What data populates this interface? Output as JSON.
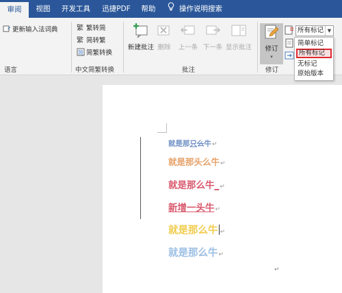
{
  "tabs": [
    {
      "label": "审阅",
      "active": true
    },
    {
      "label": "视图"
    },
    {
      "label": "开发工具"
    },
    {
      "label": "迅捷PDF"
    },
    {
      "label": "帮助"
    }
  ],
  "tell_me": "操作说明搜索",
  "ribbon": {
    "language": {
      "update_ime_label": "更新输入法词典",
      "group_label": "语言"
    },
    "chinese_conversion": {
      "trad_to_simp": "繁转简",
      "simp_to_trad": "简转繁",
      "conversion": "简繁转换",
      "group_label": "中文简繁转换"
    },
    "comments": {
      "new_comment": "新建批注",
      "delete": "删除",
      "previous": "上一条",
      "next": "下一条",
      "show_comments": "显示批注",
      "group_label": "批注"
    },
    "tracking": {
      "track_changes": "修订",
      "group_label": "修订",
      "markup_combo_value": "所有标记",
      "markup_options": [
        "简单标记",
        "所有标记",
        "无标记",
        "原始版本"
      ],
      "selected_option_index": 1
    }
  },
  "document": {
    "lines": [
      {
        "pre": "就是那",
        "ins": "只",
        "del": "么",
        "post": "牛",
        "color": "#6f8fc6",
        "size": 10.5
      },
      {
        "pre": "就是那",
        "ins": "",
        "del": "头",
        "post": "么牛",
        "color": "#e6a26a",
        "size": 12.5
      },
      {
        "pre": "就是那么牛",
        "ins": "_",
        "del": "",
        "post": "",
        "color": "#d85a6e",
        "size": 13.5
      },
      {
        "pre": "",
        "ins": "新增一头牛",
        "del": "",
        "post": "",
        "color": "#d85a6e",
        "size": 13.5
      },
      {
        "pre": "就是那么牛",
        "ins": "",
        "del": "",
        "post": "",
        "color": "#f0cc4e",
        "size": 14.5
      },
      {
        "pre": "就是那么牛",
        "ins": "",
        "del": "",
        "post": "",
        "color": "#9cbfe3",
        "size": 14.5
      }
    ],
    "paragraph_mark": "↵"
  },
  "colors": {
    "accent": "#2b579a",
    "selection_highlight": "#e0282e"
  }
}
